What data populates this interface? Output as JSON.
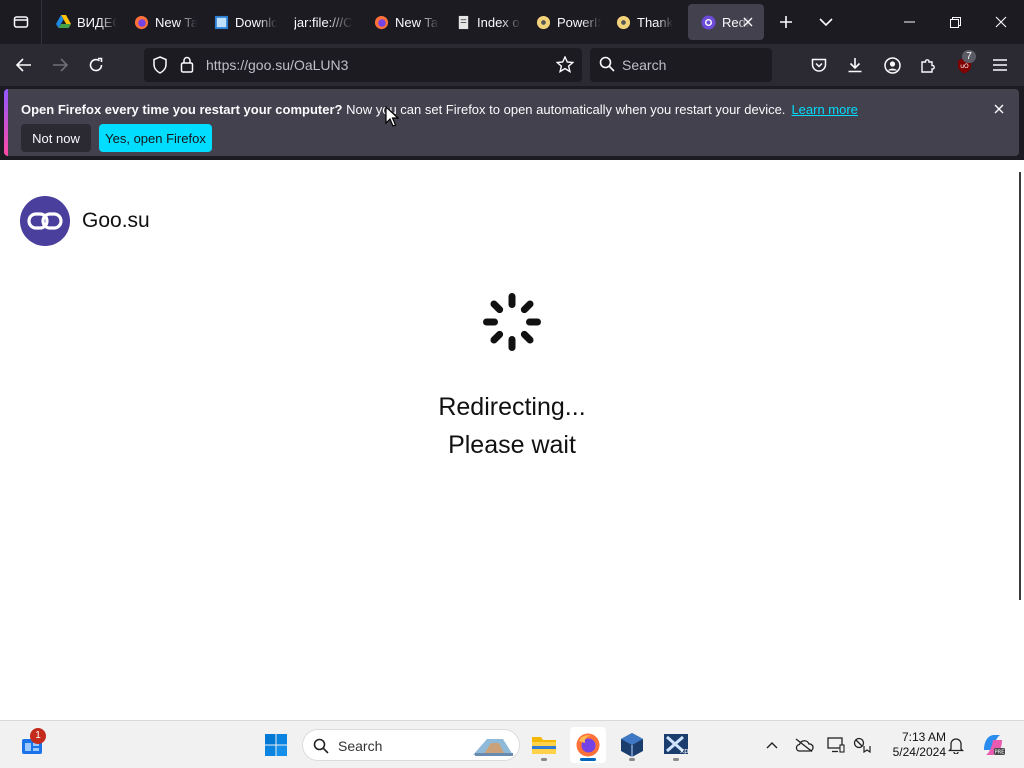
{
  "browser": {
    "tabs": [
      {
        "title": "ВИДЕО",
        "icon": "google-drive-icon"
      },
      {
        "title": "New Tab",
        "icon": "firefox-icon"
      },
      {
        "title": "Download",
        "icon": "download-page-icon"
      },
      {
        "title": "jar:file:///C",
        "icon": ""
      },
      {
        "title": "New Tab",
        "icon": "firefox-icon"
      },
      {
        "title": "Index of",
        "icon": "page-icon"
      },
      {
        "title": "PowerISO",
        "icon": "disc-icon"
      },
      {
        "title": "Thank",
        "icon": "disc-icon"
      },
      {
        "title": "Redirecting",
        "icon": "goo-su-icon",
        "active": true
      }
    ],
    "url": "https://goo.su/OaLUN3",
    "search_placeholder": "Search",
    "extension_badge": "7"
  },
  "notification": {
    "bold_text": "Open Firefox every time you restart your computer?",
    "text": " Now you can set Firefox to open automatically when you restart your device.",
    "link": "Learn more",
    "not_now": "Not now",
    "yes": "Yes, open Firefox"
  },
  "page": {
    "brand": "Goo.su",
    "line1": "Redirecting...",
    "line2": "Please wait"
  },
  "taskbar": {
    "search_placeholder": "Search",
    "time": "7:13 AM",
    "date": "5/24/2024",
    "widget_badge": "1"
  }
}
